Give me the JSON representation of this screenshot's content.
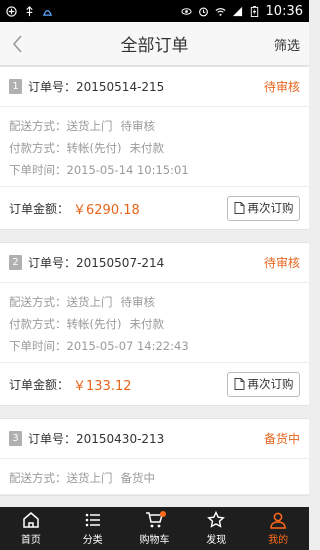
{
  "status_bar": {
    "time": "10:36"
  },
  "header": {
    "title": "全部订单",
    "filter_label": "筛选"
  },
  "orders": [
    {
      "index": "1",
      "order_no_label": "订单号：20150514-215",
      "status": "待审核",
      "delivery": "配送方式：送货上门",
      "delivery_status": "待审核",
      "payment": "付款方式：转帐(先付)",
      "payment_status": "未付款",
      "time": "下单时间：2015-05-14 10:15:01",
      "amount_label": "订单金额：",
      "amount": "￥6290.18",
      "reorder_label": "再次订购"
    },
    {
      "index": "2",
      "order_no_label": "订单号：20150507-214",
      "status": "待审核",
      "delivery": "配送方式：送货上门",
      "delivery_status": "待审核",
      "payment": "付款方式：转帐(先付)",
      "payment_status": "未付款",
      "time": "下单时间：2015-05-07 14:22:43",
      "amount_label": "订单金额：",
      "amount": "￥133.12",
      "reorder_label": "再次订购"
    },
    {
      "index": "3",
      "order_no_label": "订单号：20150430-213",
      "status": "备货中",
      "delivery": "配送方式：送货上门",
      "delivery_status": "备货中"
    }
  ],
  "tabs": [
    {
      "label": "首页",
      "icon": "home-icon"
    },
    {
      "label": "分类",
      "icon": "list-icon"
    },
    {
      "label": "购物车",
      "icon": "cart-icon"
    },
    {
      "label": "发现",
      "icon": "star-icon"
    },
    {
      "label": "我的",
      "icon": "user-icon"
    }
  ],
  "colors": {
    "accent": "#e8641b",
    "tabbar": "#1e1e1e",
    "tab_active": "#ff6a1a"
  }
}
